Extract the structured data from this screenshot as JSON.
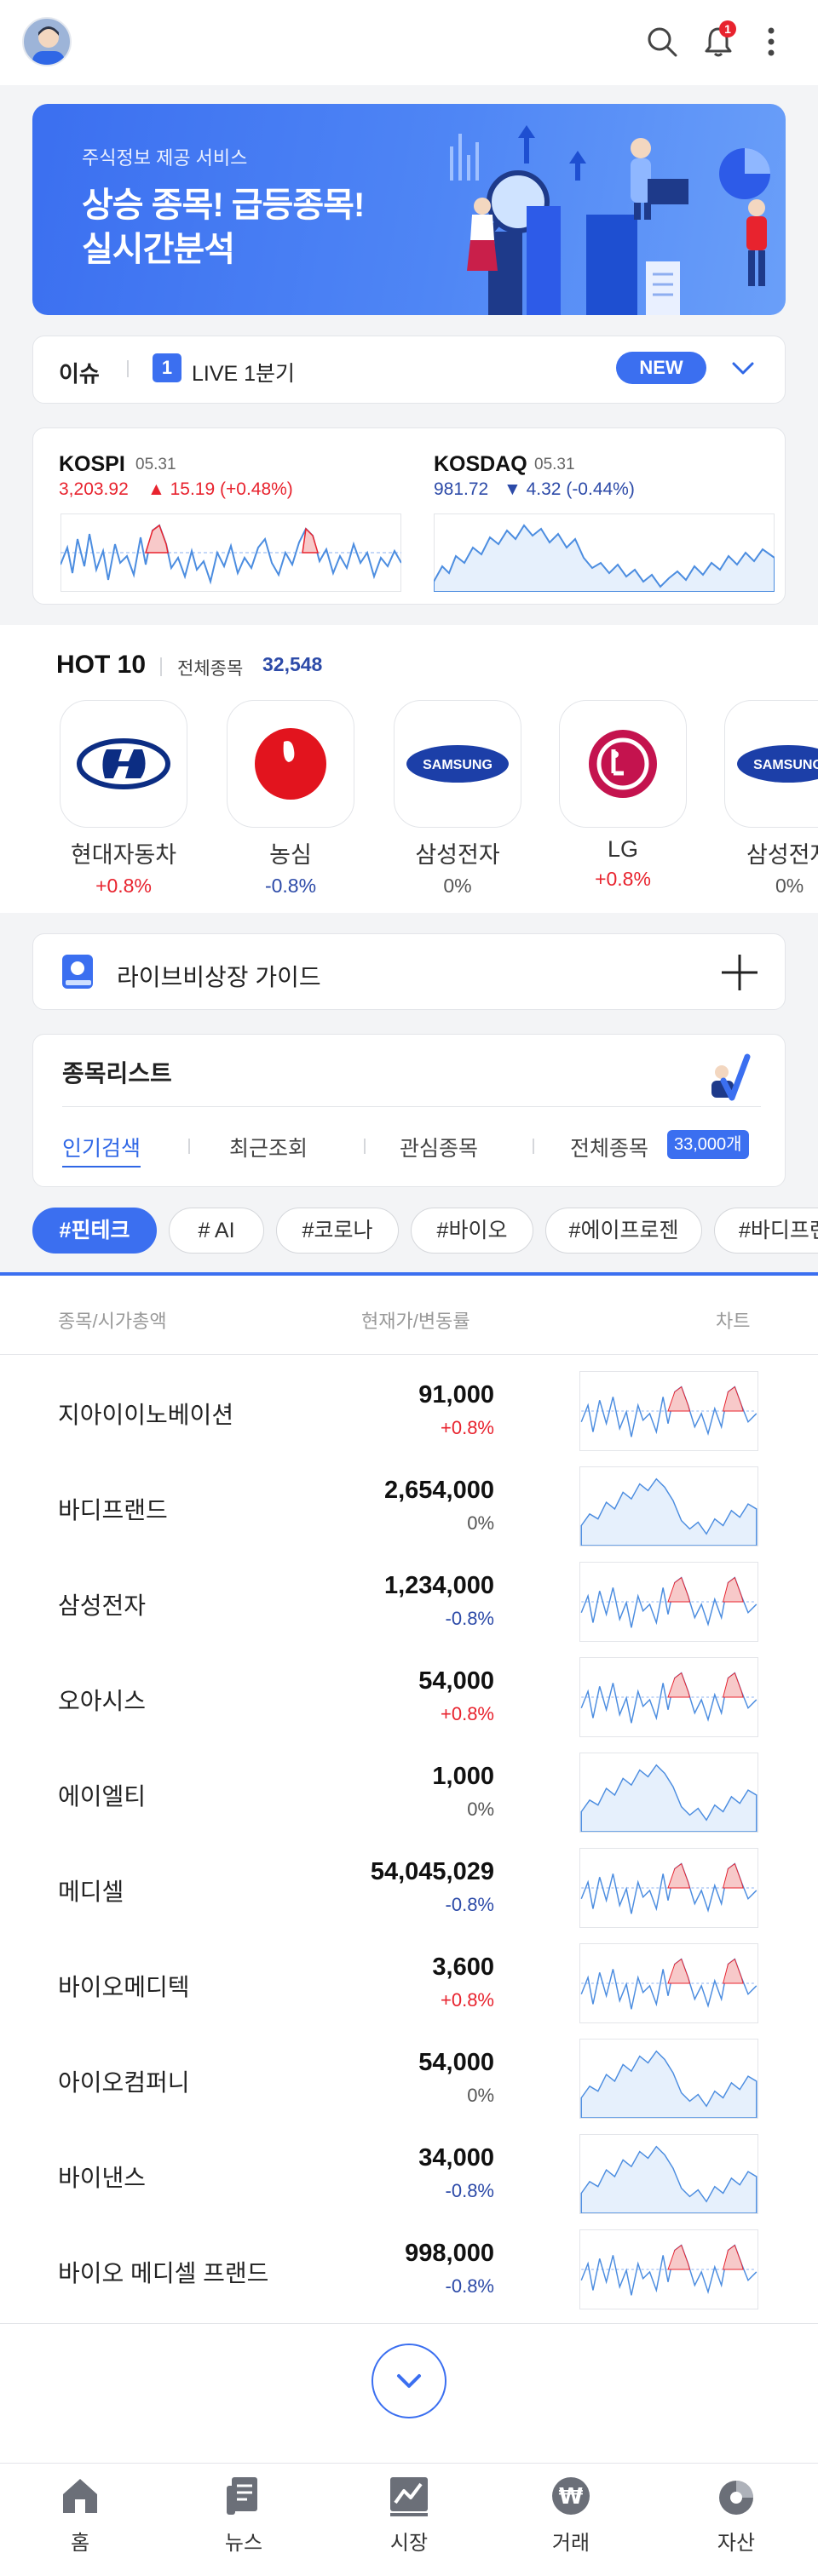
{
  "header": {
    "notification_count": "1"
  },
  "banner": {
    "subtitle": "주식정보 제공 서비스",
    "title_line1": "상승 종목! 급등종목!",
    "title_line2": "실시간분석"
  },
  "issue": {
    "label": "이슈",
    "number": "1",
    "text": "LIVE 1분기",
    "new_badge": "NEW"
  },
  "indices": [
    {
      "name": "KOSPI",
      "date": "05.31",
      "value": "3,203.92",
      "change": "▲ 15.19 (+0.48%)",
      "direction": "up"
    },
    {
      "name": "KOSDAQ",
      "date": "05.31",
      "value": "981.72",
      "change": "▼ 4.32 (-0.44%)",
      "direction": "down"
    }
  ],
  "hot10": {
    "title": "HOT 10",
    "all_label": "전체종목",
    "count": "32,548",
    "items": [
      {
        "name": "현대자동차",
        "change": "+0.8%",
        "logo": "hyundai-logo"
      },
      {
        "name": "농심",
        "change": "-0.8%",
        "logo": "nongshim-logo"
      },
      {
        "name": "삼성전자",
        "change": "0%",
        "logo": "samsung-logo"
      },
      {
        "name": "LG",
        "change": "+0.8%",
        "logo": "lg-logo"
      },
      {
        "name": "삼성전자",
        "change": "0%",
        "logo": "samsung-logo"
      }
    ]
  },
  "guide": {
    "text": "라이브비상장 가이드"
  },
  "stock_list": {
    "title": "종목리스트",
    "tabs": [
      "인기검색",
      "최근조회",
      "관심종목",
      "전체종목"
    ],
    "total_count": "33,000개"
  },
  "chips": [
    "#핀테크",
    "# AI",
    "#코로나",
    "#바이오",
    "#에이프로젠",
    "#바디프랜드"
  ],
  "columns": {
    "name": "종목/시가총액",
    "price": "현재가/변동률",
    "chart": "차트"
  },
  "rows": [
    {
      "name": "지아이이노베이션",
      "price": "91,000",
      "change": "+0.8%",
      "dir": "up"
    },
    {
      "name": "바디프랜드",
      "price": "2,654,000",
      "change": "0%",
      "dir": "zero"
    },
    {
      "name": "삼성전자",
      "price": "1,234,000",
      "change": "-0.8%",
      "dir": "dn"
    },
    {
      "name": "오아시스",
      "price": "54,000",
      "change": "+0.8%",
      "dir": "up"
    },
    {
      "name": "에이엘티",
      "price": "1,000",
      "change": "0%",
      "dir": "zero"
    },
    {
      "name": "메디셀",
      "price": "54,045,029",
      "change": "-0.8%",
      "dir": "dn"
    },
    {
      "name": "바이오메디텍",
      "price": "3,600",
      "change": "+0.8%",
      "dir": "up"
    },
    {
      "name": "아이오컴퍼니",
      "price": "54,000",
      "change": "0%",
      "dir": "zero"
    },
    {
      "name": "바이낸스",
      "price": "34,000",
      "change": "-0.8%",
      "dir": "dn"
    },
    {
      "name": "바이오 메디셀 프랜드",
      "price": "998,000",
      "change": "-0.8%",
      "dir": "dn"
    }
  ],
  "nav": [
    "홈",
    "뉴스",
    "시장",
    "거래",
    "자산"
  ],
  "colors": {
    "accent": "#3b6ff0",
    "up": "#e8232e",
    "down": "#2c4aa8"
  }
}
